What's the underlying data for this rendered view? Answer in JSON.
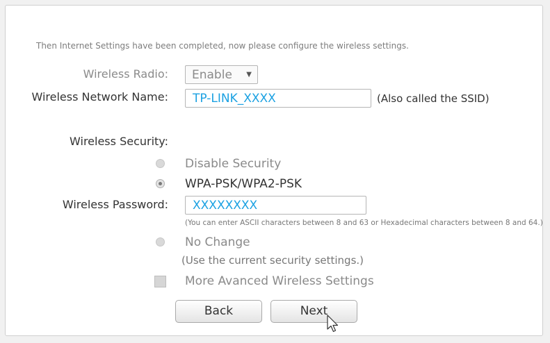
{
  "intro": "Then Internet Settings have been completed, now please configure the wireless settings.",
  "radio_label": "Wireless Radio:",
  "radio_value": "Enable",
  "network_name_label": "Wireless Network Name:",
  "ssid_value": "TP-LINK_XXXX",
  "ssid_hint": "(Also called the SSID)",
  "security_label": "Wireless Security:",
  "security_options": [
    {
      "label": "Disable Security",
      "checked": false
    },
    {
      "label": "WPA-PSK/WPA2-PSK",
      "checked": true
    }
  ],
  "password_label": "Wireless Password:",
  "password_value": "XXXXXXXX",
  "password_hint": "(You can enter ASCII characters between 8 and 63 or Hexadecimal characters between 8 and 64.)",
  "no_change_label": "No Change",
  "no_change_hint": "(Use the current security settings.)",
  "advanced_label": "More Avanced Wireless Settings",
  "back_label": "Back",
  "next_label": "Next",
  "colors": {
    "accent": "#1ba1e2",
    "muted": "#8a8a8a",
    "text": "#333333"
  }
}
